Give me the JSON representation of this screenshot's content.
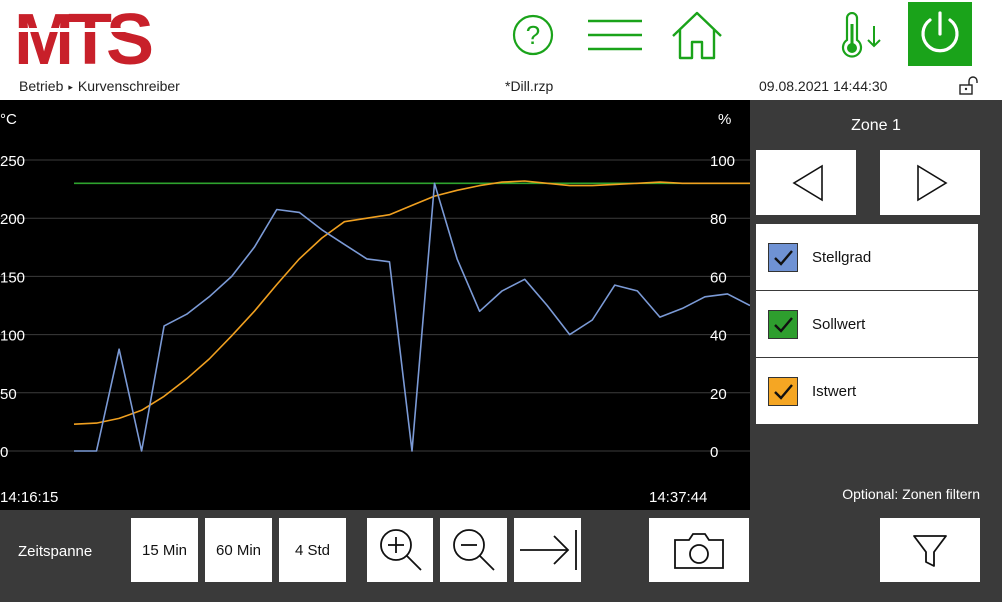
{
  "header": {
    "logo_text": "MTS",
    "breadcrumb": [
      "Betrieb",
      "Kurvenschreiber"
    ],
    "breadcrumb_separator": "▸",
    "file_name": "*Dill.rzp",
    "datetime": "09.08.2021 14:44:30",
    "icons": [
      "help-icon",
      "menu-icon",
      "home-icon",
      "thermometer-down-icon",
      "power-icon",
      "lock-open-icon"
    ]
  },
  "chart": {
    "y_left_unit": "°C",
    "y_right_unit": "%",
    "left_ticks": [
      "250",
      "200",
      "150",
      "100",
      "50",
      "0"
    ],
    "right_ticks": [
      "100",
      "80",
      "60",
      "40",
      "20",
      "0"
    ],
    "time_start": "14:16:15",
    "time_end": "14:37:44"
  },
  "chart_data": {
    "type": "line",
    "x_range": [
      "14:16:15",
      "14:37:44"
    ],
    "y_left": {
      "unit": "°C",
      "ylim": [
        0,
        250
      ]
    },
    "y_right": {
      "unit": "%",
      "ylim": [
        0,
        100
      ]
    },
    "grid": true,
    "series": [
      {
        "name": "Sollwert",
        "color": "#2ea32e",
        "axis": "left",
        "values": [
          230,
          230
        ]
      },
      {
        "name": "Istwert",
        "color": "#f0a020",
        "axis": "left",
        "values": [
          23,
          24,
          28,
          35,
          47,
          62,
          79,
          99,
          120,
          143,
          165,
          183,
          197,
          200,
          203,
          211,
          219,
          224,
          228,
          231,
          232,
          230,
          228,
          228,
          229,
          230,
          231,
          230,
          230,
          230,
          230
        ]
      },
      {
        "name": "Stellgrad",
        "color": "#7b9ad6",
        "axis": "right",
        "values": [
          0,
          0,
          35,
          0,
          43,
          47,
          53,
          60,
          70,
          83,
          82,
          76,
          71,
          66,
          65,
          0,
          92,
          66,
          48,
          55,
          59,
          50,
          40,
          45,
          57,
          55,
          46,
          49,
          53,
          54,
          50
        ]
      }
    ]
  },
  "side": {
    "zone_title": "Zone 1",
    "legend": [
      {
        "label": "Stellgrad",
        "color": "#6f92d4"
      },
      {
        "label": "Sollwert",
        "color": "#2e9e2e"
      },
      {
        "label": "Istwert",
        "color": "#f5a623"
      }
    ],
    "filter_label": "Optional: Zonen filtern"
  },
  "bottom": {
    "zeitspanne_label": "Zeitspanne",
    "time_buttons": [
      "15 Min",
      "60 Min",
      "4 Std"
    ]
  }
}
